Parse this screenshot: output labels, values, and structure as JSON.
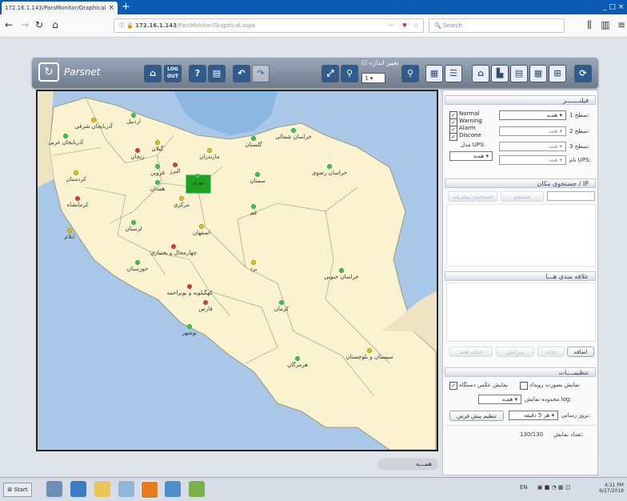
{
  "browser": {
    "tab_title": "172.16.1.143/ParsMonitor/Graphical",
    "tab_close": "×",
    "new_tab": "+",
    "window_controls": "_ □ ×",
    "url_host": "172.16.1.143",
    "url_path": "/ParsMonitor/Graphical.aspx",
    "url_menu": "···",
    "search_placeholder": "Search"
  },
  "app": {
    "logo_text": "Parsnet",
    "toolbar": {
      "logout_label": "LOG OUT",
      "size_change_label": "تغییر اندازه",
      "size_value": "1"
    },
    "map": {
      "provinces": [
        {
          "name": "آذربایجان شرقی",
          "status": "warning"
        },
        {
          "name": "اردبیل",
          "status": "normal"
        },
        {
          "name": "آذربایجان غربی",
          "status": "normal"
        },
        {
          "name": "زنجان",
          "status": "alarm"
        },
        {
          "name": "گیلان",
          "status": "warning"
        },
        {
          "name": "کردستان",
          "status": "warning"
        },
        {
          "name": "قزوین",
          "status": "normal"
        },
        {
          "name": "البرز",
          "status": "alarm"
        },
        {
          "name": "تهران",
          "status": "normal"
        },
        {
          "name": "مازندران",
          "status": "warning"
        },
        {
          "name": "گلستان",
          "status": "normal"
        },
        {
          "name": "خراسان شمالی",
          "status": "normal"
        },
        {
          "name": "خراسان رضوی",
          "status": "normal"
        },
        {
          "name": "سمنان",
          "status": "normal"
        },
        {
          "name": "قم",
          "status": "normal"
        },
        {
          "name": "مرکزی",
          "status": "warning"
        },
        {
          "name": "همدان",
          "status": "normal"
        },
        {
          "name": "کرمانشاه",
          "status": "alarm"
        },
        {
          "name": "ایلام",
          "status": "warning"
        },
        {
          "name": "لرستان",
          "status": "normal"
        },
        {
          "name": "اصفهان",
          "status": "warning"
        },
        {
          "name": "خراسان جنوبی",
          "status": "normal"
        },
        {
          "name": "چهارمحال و بختیاری",
          "status": "alarm"
        },
        {
          "name": "خوزستان",
          "status": "normal"
        },
        {
          "name": "کهگیلویه و بویراحمد",
          "status": "alarm"
        },
        {
          "name": "یزد",
          "status": "warning"
        },
        {
          "name": "فارس",
          "status": "alarm"
        },
        {
          "name": "کرمان",
          "status": "normal"
        },
        {
          "name": "بوشهر",
          "status": "normal"
        },
        {
          "name": "هرمزگان",
          "status": "normal"
        },
        {
          "name": "سیستان و بلوچستان",
          "status": "warning"
        }
      ]
    },
    "map_footer": "همـــه"
  },
  "panel": {
    "filter_title": "فیلتـــــــر",
    "level1_label": "سطح 1:",
    "level1_value": "همـه",
    "level2_label": "سطح 2:",
    "level2_value": "همه",
    "level3_label": "سطح 3:",
    "level3_value": "همه",
    "ups_name_label": "نام UPS:",
    "ups_name_value": "همه",
    "ups_model_label": "مدل UPS:",
    "ups_model_value": "همـه",
    "status_checks": [
      "Normal",
      "Warning",
      "Alarm",
      "Discone"
    ],
    "search_title": "جستجوی مکان / IP",
    "search_button": "جستجو",
    "search_button2": "جستجوی پیشرفته",
    "favorites_title": "علاقه مندی هـــا",
    "add_button": "اضافه",
    "remove_button": "حذف",
    "edit_button": "ویرایش",
    "clear_button": "حذف همه",
    "settings_title": "تنظیمــــات",
    "show_as_event_label": "نمایش بصورت رویداد",
    "show_device_image_label": "نمایش عکس دستگاه",
    "log_range_label": "محدوده نمایش log:",
    "log_range_value": "همـه",
    "update_label": "بروز رسانی:",
    "update_value": "هر 5 دقیقه",
    "default_button": "تنظیم پیش فرض",
    "count_label": "تعداد نمایش:",
    "count_value": "130/130"
  },
  "taskbar": {
    "start_label": "Start",
    "lang": "EN",
    "time": "4:31 PM",
    "date": "6/27/2018"
  },
  "colors": {
    "normal": "#2ecc40",
    "warning": "#e5c100",
    "alarm": "#e83030",
    "land": "#fbf3cf",
    "sea": "#a9c8e8"
  }
}
